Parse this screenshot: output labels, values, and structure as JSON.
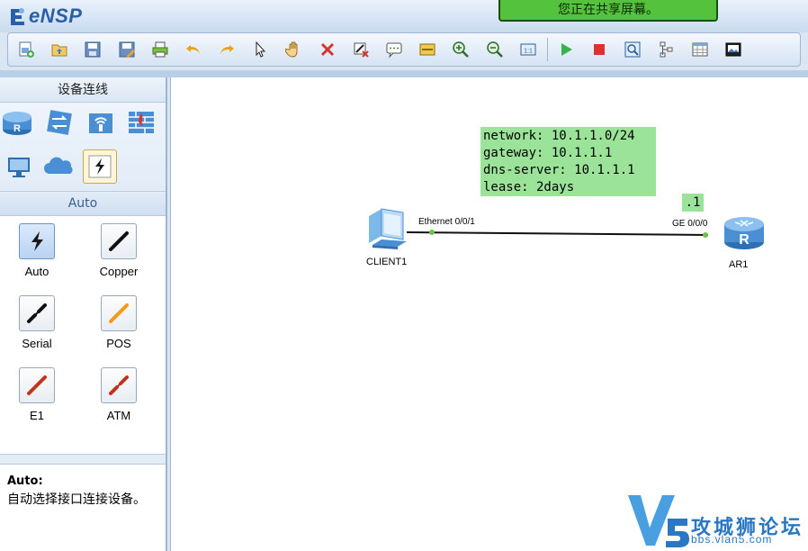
{
  "app": {
    "title": "eNSP"
  },
  "share_banner": "您正在共享屏幕。",
  "toolbar": {
    "buttons": [
      "new-topology",
      "open",
      "save",
      "save-as",
      "print",
      "undo",
      "redo",
      "select",
      "pan",
      "delete",
      "delete-link",
      "text-note",
      "palette",
      "zoom-in",
      "zoom-out",
      "fit-view",
      "start-device",
      "stop-device",
      "capture",
      "topology-view",
      "grid",
      "screenshot"
    ]
  },
  "left_panel": {
    "header": "设备连线",
    "devices": [
      "router",
      "switch",
      "wireless",
      "firewall",
      "pc",
      "cloud",
      "connection"
    ],
    "subheader": "Auto",
    "cables": [
      {
        "label": "Auto",
        "color": "#1a1a1a"
      },
      {
        "label": "Copper",
        "color": "#111111"
      },
      {
        "label": "Serial",
        "color": "#111111"
      },
      {
        "label": "POS",
        "color": "#f39a1c"
      },
      {
        "label": "E1",
        "color": "#c0341d"
      },
      {
        "label": "ATM",
        "color": "#c0341d"
      }
    ],
    "description_title": "Auto:",
    "description_text": "自动选择接口连接设备。"
  },
  "canvas": {
    "note": "network: 10.1.1.0/24\ngateway: 10.1.1.1\ndns-server: 10.1.1.1\nlease: 2days",
    "ip_label": ".1",
    "client": {
      "name": "CLIENT1",
      "port": "Ethernet 0/0/1"
    },
    "router": {
      "name": "AR1",
      "port": "GE 0/0/0"
    },
    "link_color": "#111111",
    "endpoint_color": "#6cc24a"
  },
  "watermark": {
    "text": "攻城狮论坛",
    "url": "bbs.vlan5.com",
    "logo": "V5"
  }
}
